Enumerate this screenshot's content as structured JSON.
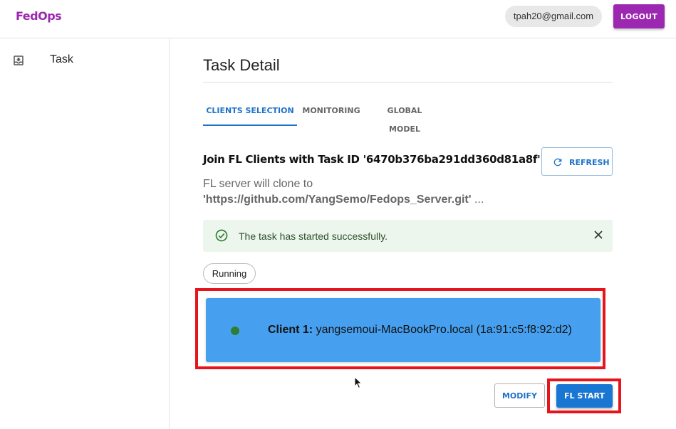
{
  "header": {
    "brand": "FedOps",
    "user_email": "tpah20@gmail.com",
    "logout_label": "LOGOUT"
  },
  "sidebar": {
    "items": [
      {
        "label": "Task",
        "icon": "inbox-icon"
      }
    ]
  },
  "main": {
    "title": "Task Detail",
    "tabs": [
      {
        "label": "CLIENTS SELECTION",
        "active": true
      },
      {
        "label": "MONITORING",
        "active": false
      },
      {
        "label": "GLOBAL MODEL",
        "active": false
      }
    ],
    "join_title": "Join FL Clients with Task ID '6470b376ba291dd360d81a8f'",
    "refresh_label": "REFRESH",
    "clone_prefix": "FL server will clone to",
    "clone_url": "'https://github.com/YangSemo/Fedops_Server.git'",
    "clone_suffix": " ...",
    "alert": {
      "message": "The task has started successfully.",
      "type": "success"
    },
    "status": "Running",
    "clients": [
      {
        "label": "Client 1:",
        "value": "yangsemoui-MacBookPro.local (1a:91:c5:f8:92:d2)",
        "status_color": "#2e7d32"
      }
    ],
    "modify_label": "MODIFY",
    "start_label": "FL START"
  },
  "colors": {
    "brand": "#9c27b0",
    "primary": "#1976d2",
    "client_card": "#46a0ef",
    "highlight": "#e8141c",
    "alert_bg": "#edf6ed"
  }
}
